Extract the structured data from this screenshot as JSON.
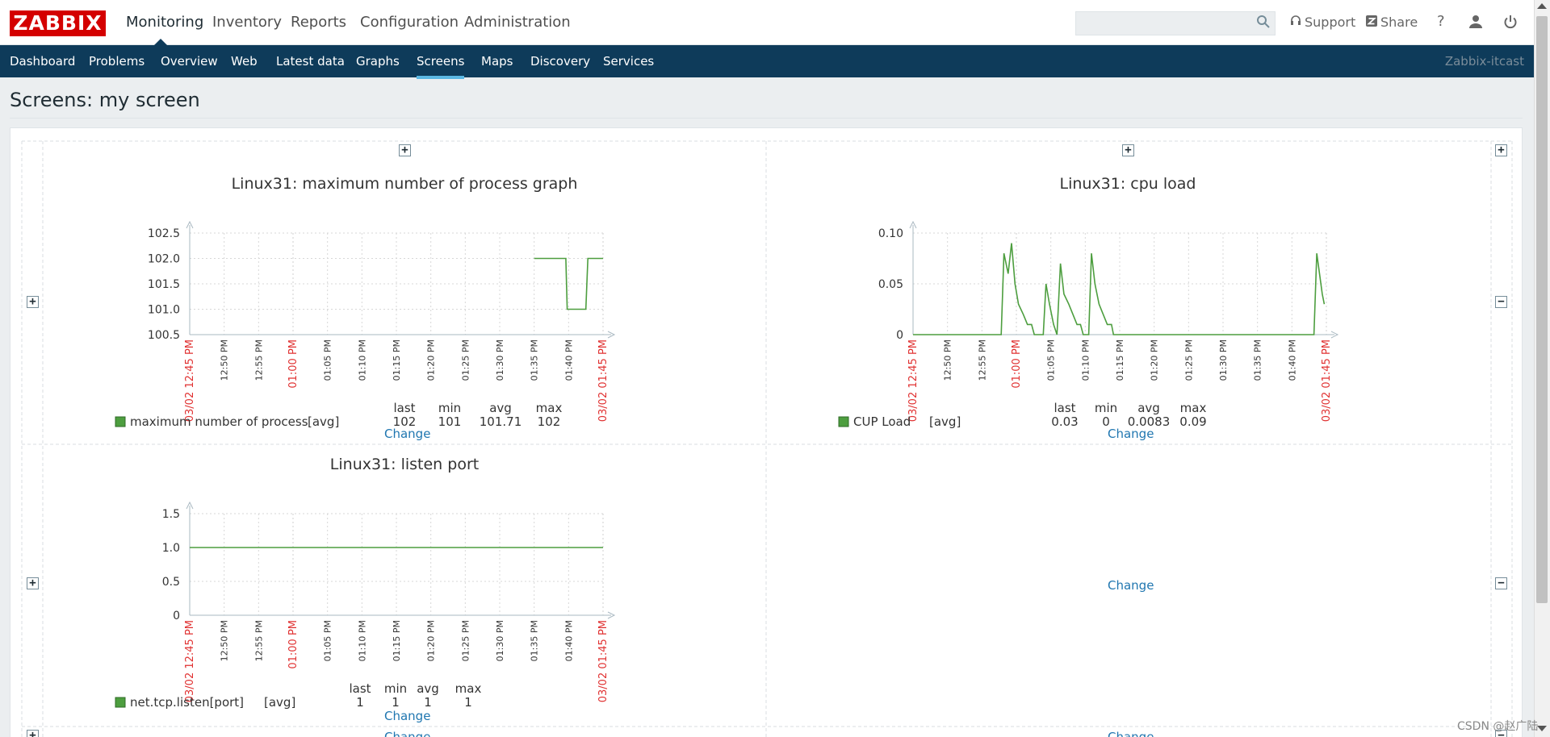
{
  "logo": "ZABBIX",
  "main_menu": [
    "Monitoring",
    "Inventory",
    "Reports",
    "Configuration",
    "Administration"
  ],
  "top_links": {
    "support": "Support",
    "share": "Share",
    "help": "?"
  },
  "sub_menu": [
    "Dashboard",
    "Problems",
    "Overview",
    "Web",
    "Latest data",
    "Graphs",
    "Screens",
    "Maps",
    "Discovery",
    "Services"
  ],
  "host_label": "Zabbix-itcast",
  "page_title": "Screens: my screen",
  "graphs": [
    {
      "title": "Linux31: maximum number of process graph",
      "change": "Change",
      "legend": {
        "headers": [
          "last",
          "min",
          "avg",
          "max"
        ],
        "name": "maximum number of process",
        "func": "[avg]",
        "values": [
          "102",
          "101",
          "101.71",
          "102"
        ]
      }
    },
    {
      "title": "Linux31: cpu load",
      "change": "Change",
      "legend": {
        "headers": [
          "last",
          "min",
          "avg",
          "max"
        ],
        "name": "CUP Load",
        "func": "[avg]",
        "values": [
          "0.03",
          "0",
          "0.0083",
          "0.09"
        ]
      }
    },
    {
      "title": "Linux31: listen port",
      "change": "Change",
      "legend": {
        "headers": [
          "last",
          "min",
          "avg",
          "max"
        ],
        "name": "net.tcp.listen[port]",
        "func": "[avg]",
        "values": [
          "1",
          "1",
          "1",
          "1"
        ]
      }
    }
  ],
  "empty_cell_change": "Change",
  "bottom_change": "Change",
  "watermark": "CSDN @赵广陆",
  "colors": {
    "series": "#4d9e3f",
    "red_label": "#e03030",
    "nav": "#0e3b5a",
    "logo": "#d40000",
    "link": "#1f76b0"
  },
  "chart_data": [
    {
      "type": "line",
      "title": "Linux31: maximum number of process graph",
      "x_ticks": [
        "03/02 12:45 PM",
        "12:50 PM",
        "12:55 PM",
        "01:00 PM",
        "01:05 PM",
        "01:10 PM",
        "01:15 PM",
        "01:20 PM",
        "01:25 PM",
        "01:30 PM",
        "01:35 PM",
        "01:40 PM",
        "03/02 01:45 PM"
      ],
      "y_ticks": [
        "102.5",
        "102.0",
        "101.5",
        "101.0",
        "100.5"
      ],
      "ylim": [
        100.5,
        102.5
      ],
      "xlim_minutes": [
        0,
        60
      ],
      "series": [
        {
          "name": "maximum number of process",
          "points": [
            [
              50,
              102
            ],
            [
              54.6,
              102
            ],
            [
              54.8,
              101
            ],
            [
              57.5,
              101
            ],
            [
              57.8,
              102
            ],
            [
              60,
              102
            ]
          ]
        }
      ]
    },
    {
      "type": "line",
      "title": "Linux31: cpu load",
      "x_ticks": [
        "03/02 12:45 PM",
        "12:50 PM",
        "12:55 PM",
        "01:00 PM",
        "01:05 PM",
        "01:10 PM",
        "01:15 PM",
        "01:20 PM",
        "01:25 PM",
        "01:30 PM",
        "01:35 PM",
        "01:40 PM",
        "03/02 01:45 PM"
      ],
      "y_ticks": [
        "0.10",
        "0.05",
        "0"
      ],
      "ylim": [
        0,
        0.1
      ],
      "xlim_minutes": [
        0,
        60
      ],
      "series": [
        {
          "name": "CUP Load",
          "points": [
            [
              0,
              0
            ],
            [
              12.8,
              0
            ],
            [
              13.2,
              0.08
            ],
            [
              13.8,
              0.06
            ],
            [
              14.3,
              0.09
            ],
            [
              14.8,
              0.05
            ],
            [
              15.3,
              0.03
            ],
            [
              16,
              0.02
            ],
            [
              16.6,
              0.01
            ],
            [
              17.2,
              0.01
            ],
            [
              17.6,
              0
            ],
            [
              18.9,
              0
            ],
            [
              19.3,
              0.05
            ],
            [
              19.8,
              0.03
            ],
            [
              20.4,
              0.01
            ],
            [
              20.9,
              0
            ],
            [
              21.4,
              0.07
            ],
            [
              21.9,
              0.04
            ],
            [
              22.6,
              0.03
            ],
            [
              23.2,
              0.02
            ],
            [
              23.8,
              0.01
            ],
            [
              24.3,
              0.01
            ],
            [
              24.7,
              0
            ],
            [
              25.5,
              0
            ],
            [
              25.9,
              0.08
            ],
            [
              26.4,
              0.05
            ],
            [
              27,
              0.03
            ],
            [
              27.6,
              0.02
            ],
            [
              28.2,
              0.01
            ],
            [
              28.8,
              0.01
            ],
            [
              29.1,
              0
            ],
            [
              58.2,
              0
            ],
            [
              58.6,
              0.08
            ],
            [
              59,
              0.06
            ],
            [
              59.4,
              0.04
            ],
            [
              59.7,
              0.03
            ]
          ]
        }
      ]
    },
    {
      "type": "line",
      "title": "Linux31: listen port",
      "x_ticks": [
        "03/02 12:45 PM",
        "12:50 PM",
        "12:55 PM",
        "01:00 PM",
        "01:05 PM",
        "01:10 PM",
        "01:15 PM",
        "01:20 PM",
        "01:25 PM",
        "01:30 PM",
        "01:35 PM",
        "01:40 PM",
        "03/02 01:45 PM"
      ],
      "y_ticks": [
        "1.5",
        "1.0",
        "0.5",
        "0"
      ],
      "ylim": [
        0,
        1.5
      ],
      "xlim_minutes": [
        0,
        60
      ],
      "series": [
        {
          "name": "net.tcp.listen[port]",
          "points": [
            [
              0,
              1
            ],
            [
              60,
              1
            ]
          ]
        }
      ]
    }
  ]
}
